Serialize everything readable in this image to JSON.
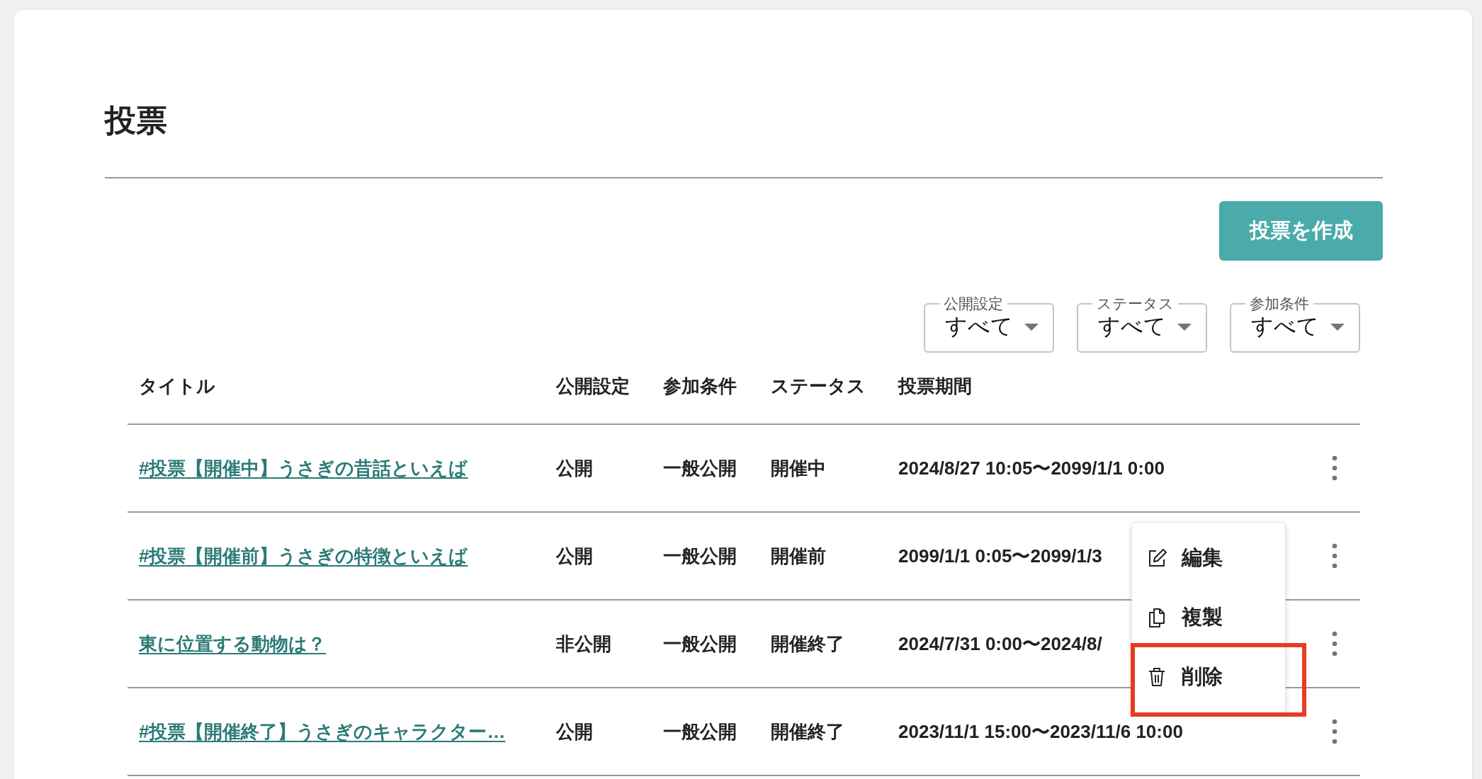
{
  "page": {
    "title": "投票"
  },
  "create_button": "投票を作成",
  "filters": [
    {
      "label": "公開設定",
      "value": "すべて"
    },
    {
      "label": "ステータス",
      "value": "すべて"
    },
    {
      "label": "参加条件",
      "value": "すべて"
    }
  ],
  "table": {
    "columns": [
      "タイトル",
      "公開設定",
      "参加条件",
      "ステータス",
      "投票期間"
    ],
    "rows": [
      {
        "title": "#投票【開催中】うさぎの昔話といえば",
        "visibility": "公開",
        "condition": "一般公開",
        "status": "開催中",
        "period": "2024/8/27 10:05〜2099/1/1 0:00"
      },
      {
        "title": "#投票【開催前】うさぎの特徴といえば",
        "visibility": "公開",
        "condition": "一般公開",
        "status": "開催前",
        "period": "2099/1/1 0:05〜2099/1/3"
      },
      {
        "title": "東に位置する動物は？",
        "visibility": "非公開",
        "condition": "一般公開",
        "status": "開催終了",
        "period": "2024/7/31 0:00〜2024/8/"
      },
      {
        "title": "#投票【開催終了】うさぎのキャラクター…",
        "visibility": "公開",
        "condition": "一般公開",
        "status": "開催終了",
        "period": "2023/11/1 15:00〜2023/11/6 10:00"
      }
    ]
  },
  "row_menu": [
    {
      "label": "編集",
      "highlighted": false
    },
    {
      "label": "複製",
      "highlighted": false
    },
    {
      "label": "削除",
      "highlighted": true
    }
  ]
}
